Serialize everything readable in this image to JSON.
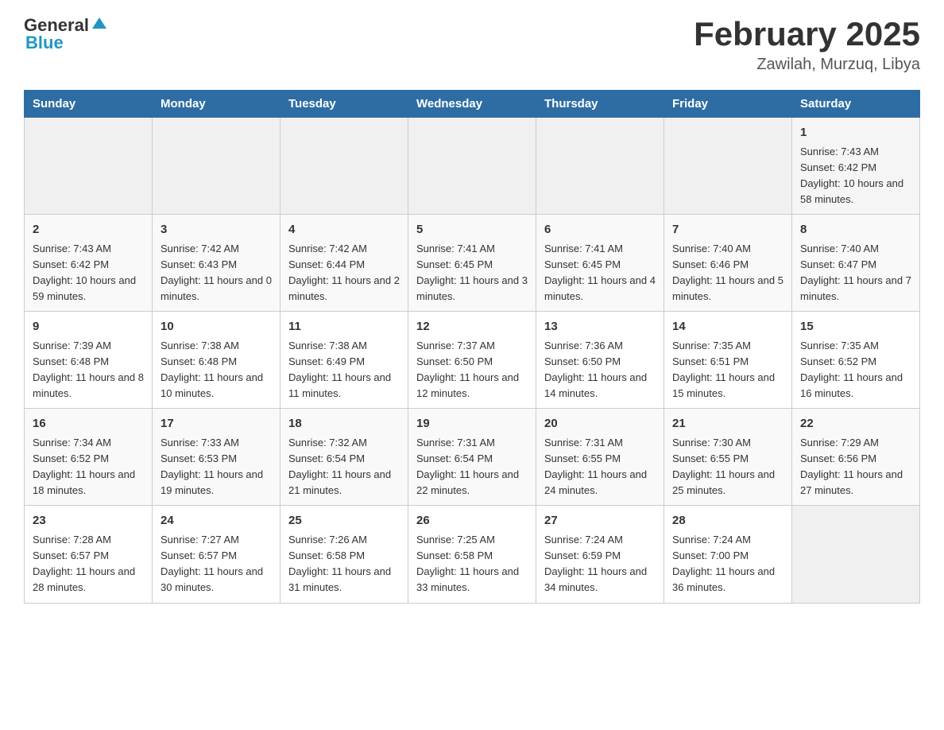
{
  "header": {
    "logo_general": "General",
    "logo_blue": "Blue",
    "title": "February 2025",
    "location": "Zawilah, Murzuq, Libya"
  },
  "days_of_week": [
    "Sunday",
    "Monday",
    "Tuesday",
    "Wednesday",
    "Thursday",
    "Friday",
    "Saturday"
  ],
  "weeks": [
    [
      {
        "day": "",
        "sunrise": "",
        "sunset": "",
        "daylight": ""
      },
      {
        "day": "",
        "sunrise": "",
        "sunset": "",
        "daylight": ""
      },
      {
        "day": "",
        "sunrise": "",
        "sunset": "",
        "daylight": ""
      },
      {
        "day": "",
        "sunrise": "",
        "sunset": "",
        "daylight": ""
      },
      {
        "day": "",
        "sunrise": "",
        "sunset": "",
        "daylight": ""
      },
      {
        "day": "",
        "sunrise": "",
        "sunset": "",
        "daylight": ""
      },
      {
        "day": "1",
        "sunrise": "Sunrise: 7:43 AM",
        "sunset": "Sunset: 6:42 PM",
        "daylight": "Daylight: 10 hours and 58 minutes."
      }
    ],
    [
      {
        "day": "2",
        "sunrise": "Sunrise: 7:43 AM",
        "sunset": "Sunset: 6:42 PM",
        "daylight": "Daylight: 10 hours and 59 minutes."
      },
      {
        "day": "3",
        "sunrise": "Sunrise: 7:42 AM",
        "sunset": "Sunset: 6:43 PM",
        "daylight": "Daylight: 11 hours and 0 minutes."
      },
      {
        "day": "4",
        "sunrise": "Sunrise: 7:42 AM",
        "sunset": "Sunset: 6:44 PM",
        "daylight": "Daylight: 11 hours and 2 minutes."
      },
      {
        "day": "5",
        "sunrise": "Sunrise: 7:41 AM",
        "sunset": "Sunset: 6:45 PM",
        "daylight": "Daylight: 11 hours and 3 minutes."
      },
      {
        "day": "6",
        "sunrise": "Sunrise: 7:41 AM",
        "sunset": "Sunset: 6:45 PM",
        "daylight": "Daylight: 11 hours and 4 minutes."
      },
      {
        "day": "7",
        "sunrise": "Sunrise: 7:40 AM",
        "sunset": "Sunset: 6:46 PM",
        "daylight": "Daylight: 11 hours and 5 minutes."
      },
      {
        "day": "8",
        "sunrise": "Sunrise: 7:40 AM",
        "sunset": "Sunset: 6:47 PM",
        "daylight": "Daylight: 11 hours and 7 minutes."
      }
    ],
    [
      {
        "day": "9",
        "sunrise": "Sunrise: 7:39 AM",
        "sunset": "Sunset: 6:48 PM",
        "daylight": "Daylight: 11 hours and 8 minutes."
      },
      {
        "day": "10",
        "sunrise": "Sunrise: 7:38 AM",
        "sunset": "Sunset: 6:48 PM",
        "daylight": "Daylight: 11 hours and 10 minutes."
      },
      {
        "day": "11",
        "sunrise": "Sunrise: 7:38 AM",
        "sunset": "Sunset: 6:49 PM",
        "daylight": "Daylight: 11 hours and 11 minutes."
      },
      {
        "day": "12",
        "sunrise": "Sunrise: 7:37 AM",
        "sunset": "Sunset: 6:50 PM",
        "daylight": "Daylight: 11 hours and 12 minutes."
      },
      {
        "day": "13",
        "sunrise": "Sunrise: 7:36 AM",
        "sunset": "Sunset: 6:50 PM",
        "daylight": "Daylight: 11 hours and 14 minutes."
      },
      {
        "day": "14",
        "sunrise": "Sunrise: 7:35 AM",
        "sunset": "Sunset: 6:51 PM",
        "daylight": "Daylight: 11 hours and 15 minutes."
      },
      {
        "day": "15",
        "sunrise": "Sunrise: 7:35 AM",
        "sunset": "Sunset: 6:52 PM",
        "daylight": "Daylight: 11 hours and 16 minutes."
      }
    ],
    [
      {
        "day": "16",
        "sunrise": "Sunrise: 7:34 AM",
        "sunset": "Sunset: 6:52 PM",
        "daylight": "Daylight: 11 hours and 18 minutes."
      },
      {
        "day": "17",
        "sunrise": "Sunrise: 7:33 AM",
        "sunset": "Sunset: 6:53 PM",
        "daylight": "Daylight: 11 hours and 19 minutes."
      },
      {
        "day": "18",
        "sunrise": "Sunrise: 7:32 AM",
        "sunset": "Sunset: 6:54 PM",
        "daylight": "Daylight: 11 hours and 21 minutes."
      },
      {
        "day": "19",
        "sunrise": "Sunrise: 7:31 AM",
        "sunset": "Sunset: 6:54 PM",
        "daylight": "Daylight: 11 hours and 22 minutes."
      },
      {
        "day": "20",
        "sunrise": "Sunrise: 7:31 AM",
        "sunset": "Sunset: 6:55 PM",
        "daylight": "Daylight: 11 hours and 24 minutes."
      },
      {
        "day": "21",
        "sunrise": "Sunrise: 7:30 AM",
        "sunset": "Sunset: 6:55 PM",
        "daylight": "Daylight: 11 hours and 25 minutes."
      },
      {
        "day": "22",
        "sunrise": "Sunrise: 7:29 AM",
        "sunset": "Sunset: 6:56 PM",
        "daylight": "Daylight: 11 hours and 27 minutes."
      }
    ],
    [
      {
        "day": "23",
        "sunrise": "Sunrise: 7:28 AM",
        "sunset": "Sunset: 6:57 PM",
        "daylight": "Daylight: 11 hours and 28 minutes."
      },
      {
        "day": "24",
        "sunrise": "Sunrise: 7:27 AM",
        "sunset": "Sunset: 6:57 PM",
        "daylight": "Daylight: 11 hours and 30 minutes."
      },
      {
        "day": "25",
        "sunrise": "Sunrise: 7:26 AM",
        "sunset": "Sunset: 6:58 PM",
        "daylight": "Daylight: 11 hours and 31 minutes."
      },
      {
        "day": "26",
        "sunrise": "Sunrise: 7:25 AM",
        "sunset": "Sunset: 6:58 PM",
        "daylight": "Daylight: 11 hours and 33 minutes."
      },
      {
        "day": "27",
        "sunrise": "Sunrise: 7:24 AM",
        "sunset": "Sunset: 6:59 PM",
        "daylight": "Daylight: 11 hours and 34 minutes."
      },
      {
        "day": "28",
        "sunrise": "Sunrise: 7:24 AM",
        "sunset": "Sunset: 7:00 PM",
        "daylight": "Daylight: 11 hours and 36 minutes."
      },
      {
        "day": "",
        "sunrise": "",
        "sunset": "",
        "daylight": ""
      }
    ]
  ]
}
